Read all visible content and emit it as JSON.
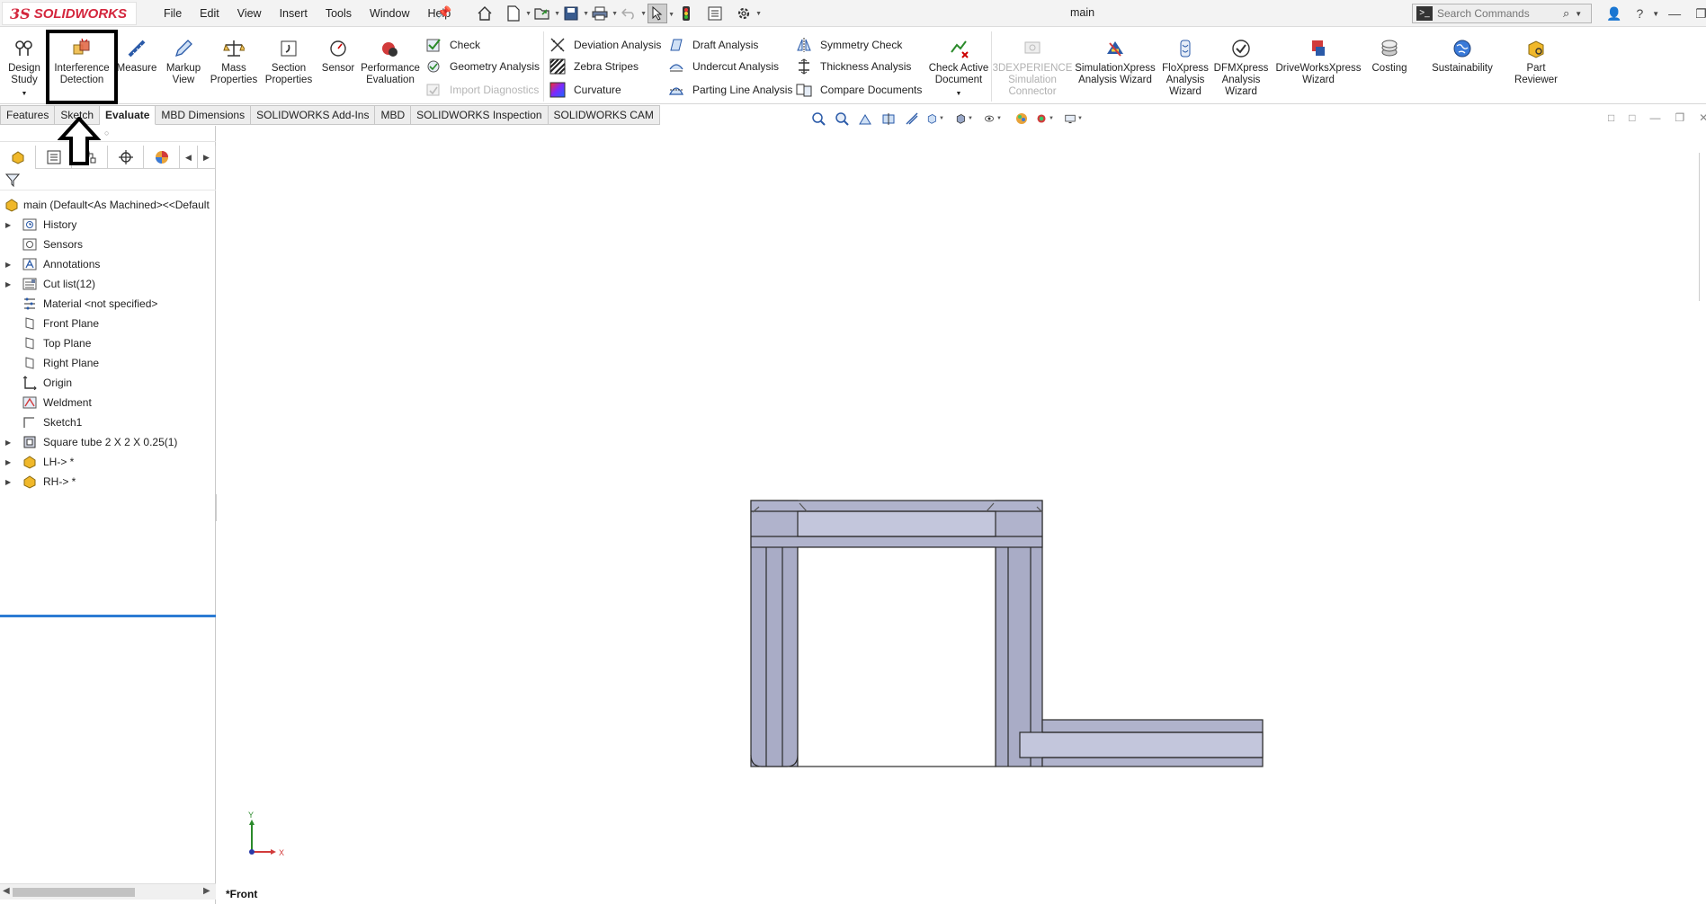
{
  "app": {
    "brand_mark": "3S",
    "brand_name": "SOLIDWORKS",
    "document_title": "main"
  },
  "menu": [
    "File",
    "Edit",
    "View",
    "Insert",
    "Tools",
    "Window",
    "Help"
  ],
  "search": {
    "placeholder": "Search Commands"
  },
  "ribbon": {
    "design_study": "Design Study",
    "interference_detection": "Interference Detection",
    "measure": "Measure",
    "markup_view": "Markup View",
    "mass_properties": "Mass Properties",
    "section_properties": "Section Properties",
    "sensor": "Sensor",
    "performance_evaluation": "Performance Evaluation",
    "check": "Check",
    "geometry_analysis": "Geometry Analysis",
    "import_diagnostics": "Import Diagnostics",
    "deviation_analysis": "Deviation Analysis",
    "zebra_stripes": "Zebra Stripes",
    "curvature": "Curvature",
    "draft_analysis": "Draft Analysis",
    "undercut_analysis": "Undercut Analysis",
    "parting_line_analysis": "Parting Line Analysis",
    "symmetry_check": "Symmetry Check",
    "thickness_analysis": "Thickness Analysis",
    "compare_documents": "Compare Documents",
    "check_active_document": "Check Active Document",
    "threedx_simulation": "3DEXPERIENCE Simulation Connector",
    "simulationxpress": "SimulationXpress Analysis Wizard",
    "floxpress": "FloXpress Analysis Wizard",
    "dfmxpress": "DFMXpress Analysis Wizard",
    "driveworksxpress": "DriveWorksXpress Wizard",
    "costing": "Costing",
    "sustainability": "Sustainability",
    "part_reviewer": "Part Reviewer"
  },
  "tabs": [
    "Features",
    "Sketch",
    "Evaluate",
    "MBD Dimensions",
    "SOLIDWORKS Add-Ins",
    "MBD",
    "SOLIDWORKS Inspection",
    "SOLIDWORKS CAM"
  ],
  "active_tab": "Evaluate",
  "tree": {
    "root": "main  (Default<As Machined><<Default",
    "items": [
      {
        "label": "History",
        "expandable": true
      },
      {
        "label": "Sensors",
        "expandable": false
      },
      {
        "label": "Annotations",
        "expandable": true
      },
      {
        "label": "Cut list(12)",
        "expandable": true
      },
      {
        "label": "Material <not specified>",
        "expandable": false
      },
      {
        "label": "Front Plane",
        "expandable": false
      },
      {
        "label": "Top Plane",
        "expandable": false
      },
      {
        "label": "Right Plane",
        "expandable": false
      },
      {
        "label": "Origin",
        "expandable": false
      },
      {
        "label": "Weldment",
        "expandable": false
      },
      {
        "label": "Sketch1",
        "expandable": false
      },
      {
        "label": "Square tube 2 X 2 X 0.25(1)",
        "expandable": true
      },
      {
        "label": "LH-> *",
        "expandable": true
      },
      {
        "label": "RH-> *",
        "expandable": true
      }
    ]
  },
  "viewport": {
    "view_name": "*Front",
    "triad_y": "Y",
    "triad_x": "X"
  },
  "colors": {
    "accent": "#2c7bd3",
    "brand": "#d4263d",
    "model_fill": "#a9acc6",
    "model_edge": "#2a2a2a"
  }
}
